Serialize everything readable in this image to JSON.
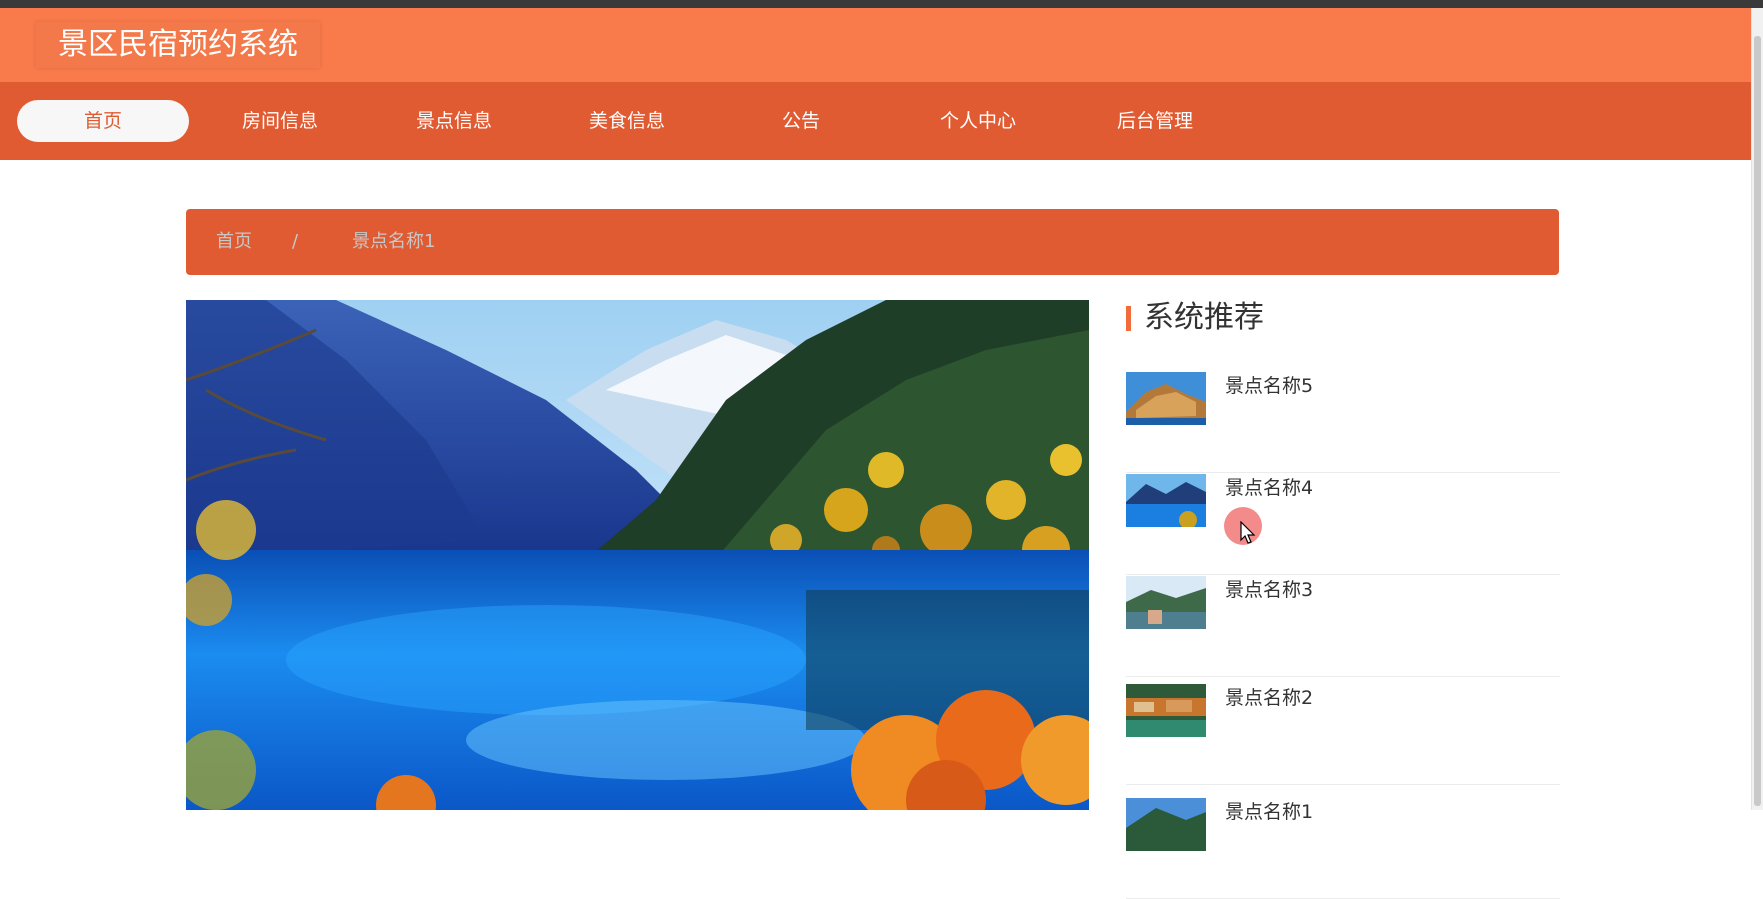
{
  "app": {
    "title": "景区民宿预约系统"
  },
  "nav": {
    "items": [
      {
        "label": "首页",
        "active": true
      },
      {
        "label": "房间信息"
      },
      {
        "label": "景点信息"
      },
      {
        "label": "美食信息"
      },
      {
        "label": "公告"
      },
      {
        "label": "个人中心"
      },
      {
        "label": "后台管理"
      }
    ]
  },
  "breadcrumb": {
    "home": "首页",
    "separator": "/",
    "current": "景点名称1"
  },
  "sidebar": {
    "title": "系统推荐",
    "items": [
      {
        "name": "景点名称5"
      },
      {
        "name": "景点名称4"
      },
      {
        "name": "景点名称3"
      },
      {
        "name": "景点名称2"
      },
      {
        "name": "景点名称1"
      }
    ]
  },
  "colors": {
    "header": "#f97a4a",
    "navbar": "#e05b32",
    "accent": "#f26b3a"
  }
}
